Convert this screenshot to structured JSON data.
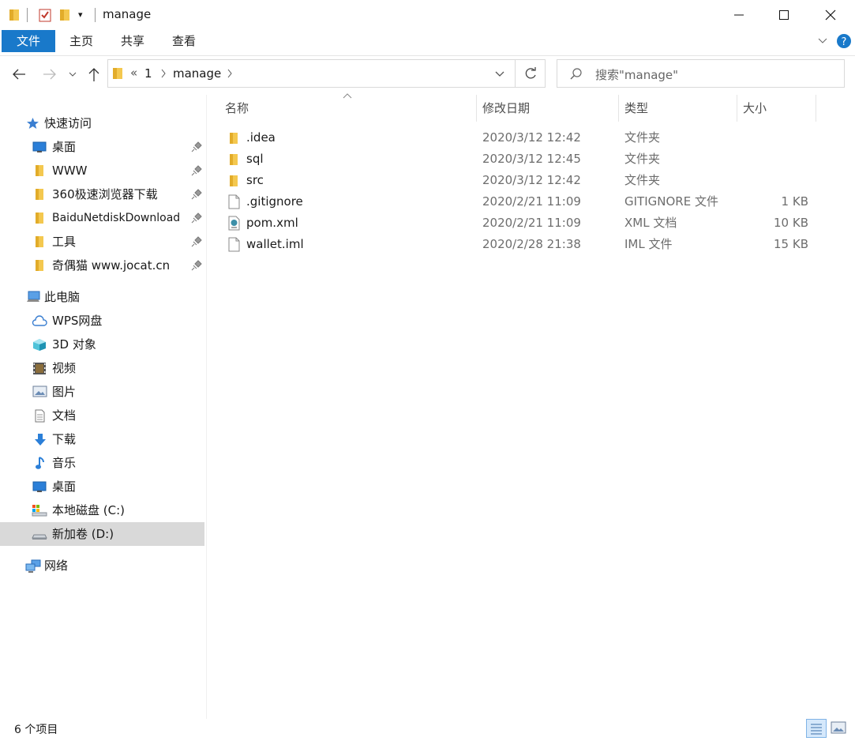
{
  "window": {
    "title": "manage",
    "controls": {
      "minimize_icon": "minimize-icon",
      "maximize_icon": "maximize-icon",
      "close_icon": "close-icon"
    }
  },
  "ribbon": {
    "tabs": [
      "文件",
      "主页",
      "共享",
      "查看"
    ],
    "accent_color": "#1979ca"
  },
  "address": {
    "overflow": "«",
    "crumbs": [
      "1",
      "manage"
    ],
    "search_placeholder": "搜索\"manage\""
  },
  "nav": {
    "quick_access_label": "快速访问",
    "quick_items": [
      "桌面",
      "WWW",
      "360极速浏览器下载",
      "BaiduNetdiskDownload",
      "工具",
      "奇偶猫 www.jocat.cn"
    ],
    "this_pc_label": "此电脑",
    "pc_items": [
      "WPS网盘",
      "3D 对象",
      "视频",
      "图片",
      "文档",
      "下载",
      "音乐",
      "桌面",
      "本地磁盘 (C:)",
      "新加卷 (D:)"
    ],
    "network_label": "网络"
  },
  "columns": {
    "name": "名称",
    "date": "修改日期",
    "type": "类型",
    "size": "大小"
  },
  "files": [
    {
      "name": ".idea",
      "date": "2020/3/12 12:42",
      "type": "文件夹",
      "size": "",
      "icon": "folder-icon"
    },
    {
      "name": "sql",
      "date": "2020/3/12 12:45",
      "type": "文件夹",
      "size": "",
      "icon": "folder-icon"
    },
    {
      "name": "src",
      "date": "2020/3/12 12:42",
      "type": "文件夹",
      "size": "",
      "icon": "folder-icon"
    },
    {
      "name": ".gitignore",
      "date": "2020/2/21 11:09",
      "type": "GITIGNORE 文件",
      "size": "1 KB",
      "icon": "file-icon"
    },
    {
      "name": "pom.xml",
      "date": "2020/2/21 11:09",
      "type": "XML 文档",
      "size": "10 KB",
      "icon": "xml-file-icon"
    },
    {
      "name": "wallet.iml",
      "date": "2020/2/28 21:38",
      "type": "IML 文件",
      "size": "15 KB",
      "icon": "file-icon"
    }
  ],
  "status": {
    "count": "6 个项目"
  }
}
